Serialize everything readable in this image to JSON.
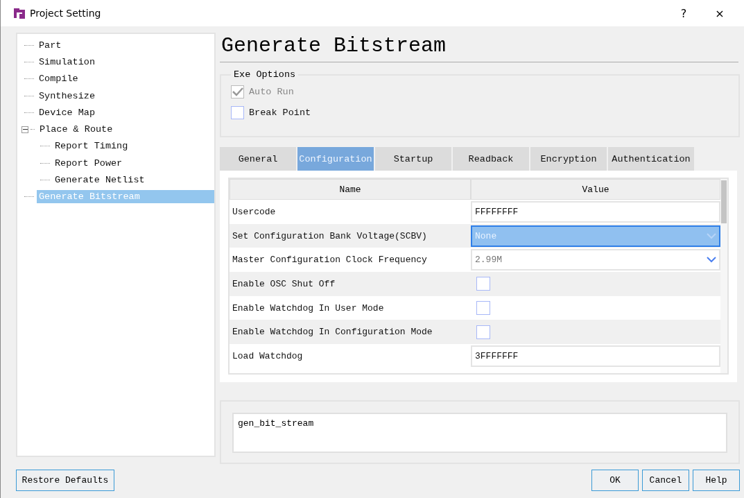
{
  "window": {
    "title": "Project Setting",
    "help": "?",
    "close": "×"
  },
  "tree": [
    {
      "label": "Part",
      "selected": false
    },
    {
      "label": "Simulation",
      "selected": false
    },
    {
      "label": "Compile",
      "selected": false
    },
    {
      "label": "Synthesize",
      "selected": false
    },
    {
      "label": "Device Map",
      "selected": false
    },
    {
      "label": "Place & Route",
      "selected": false,
      "expanded": true,
      "children": [
        {
          "label": "Report Timing",
          "selected": false
        },
        {
          "label": "Report Power",
          "selected": false
        },
        {
          "label": "Generate Netlist",
          "selected": false
        }
      ]
    },
    {
      "label": "Generate Bitstream",
      "selected": true
    }
  ],
  "heading": "Generate Bitstream",
  "exe_options": {
    "title": "Exe Options",
    "options": [
      {
        "label": "Auto Run",
        "checked": true,
        "disabled": true
      },
      {
        "label": "Break Point",
        "checked": false,
        "disabled": false
      }
    ]
  },
  "tabs": [
    {
      "label": "General",
      "selected": false
    },
    {
      "label": "Configuration",
      "selected": true
    },
    {
      "label": "Startup",
      "selected": false
    },
    {
      "label": "Readback",
      "selected": false
    },
    {
      "label": "Encryption",
      "selected": false
    },
    {
      "label": "Authentication",
      "selected": false
    }
  ],
  "table": {
    "columns": [
      "Name",
      "Value"
    ],
    "rows": [
      {
        "name": "Usercode",
        "kind": "text",
        "value": "FFFFFFFF",
        "selected": false
      },
      {
        "name": "Set Configuration Bank Voltage(SCBV)",
        "kind": "select",
        "value": "None",
        "selected": true
      },
      {
        "name": "Master Configuration Clock Frequency",
        "kind": "select",
        "value": "2.99M",
        "selected": false
      },
      {
        "name": "Enable OSC Shut Off",
        "kind": "checkbox",
        "checked": false,
        "selected": false
      },
      {
        "name": "Enable Watchdog In User Mode",
        "kind": "checkbox",
        "checked": false,
        "selected": false
      },
      {
        "name": "Enable Watchdog In Configuration Mode",
        "kind": "checkbox",
        "checked": false,
        "selected": false
      },
      {
        "name": "Load Watchdog",
        "kind": "text",
        "value": "3FFFFFFF",
        "selected": false
      }
    ]
  },
  "command": "gen_bit_stream",
  "buttons": {
    "restore": "Restore Defaults",
    "actions": [
      "OK",
      "Cancel",
      "Help"
    ]
  }
}
